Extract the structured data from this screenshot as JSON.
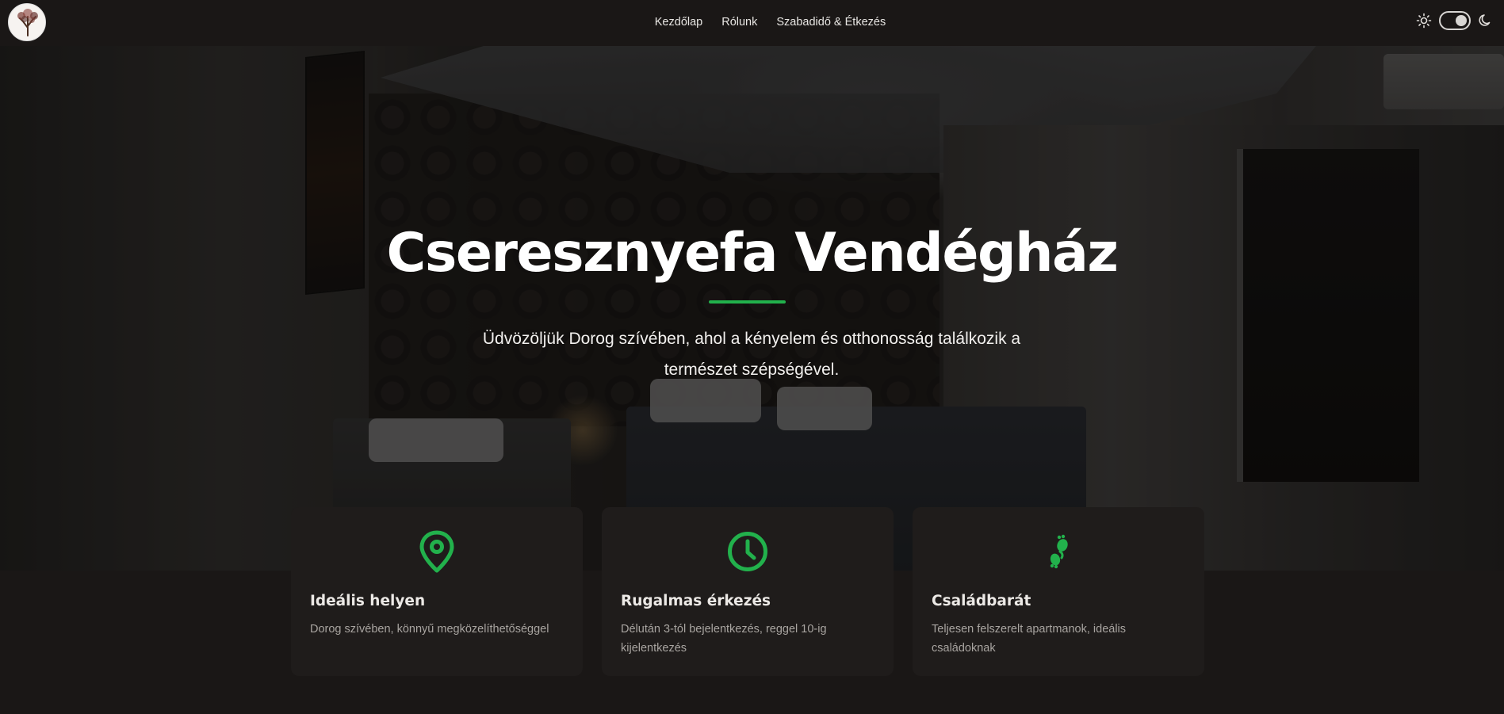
{
  "navbar": {
    "logo_alt": "tree-logo",
    "links": [
      {
        "label": "Kezdőlap"
      },
      {
        "label": "Rólunk"
      },
      {
        "label": "Szabadidő & Étkezés"
      }
    ],
    "theme": {
      "light_icon": "sun-icon",
      "dark_icon": "moon-icon",
      "mode": "dark"
    }
  },
  "hero": {
    "title": "Cseresznyefa Vendégház",
    "subtitle": "Üdvözöljük Dorog szívében, ahol a kényelem és otthonosság találkozik a természet szépségével."
  },
  "features": [
    {
      "icon": "map-pin-icon",
      "title": "Ideális helyen",
      "description": "Dorog szívében, könnyű megközelíthetőséggel"
    },
    {
      "icon": "clock-icon",
      "title": "Rugalmas érkezés",
      "description": "Délután 3-tól bejelentkezés, reggel 10-ig kijelentkezés"
    },
    {
      "icon": "baby-footprints-icon",
      "title": "Családbarát",
      "description": "Teljesen felszerelt apartmanok, ideális családoknak"
    }
  ],
  "colors": {
    "accent": "#22b14c",
    "background": "#1a1716",
    "card": "#1f1c1b"
  }
}
